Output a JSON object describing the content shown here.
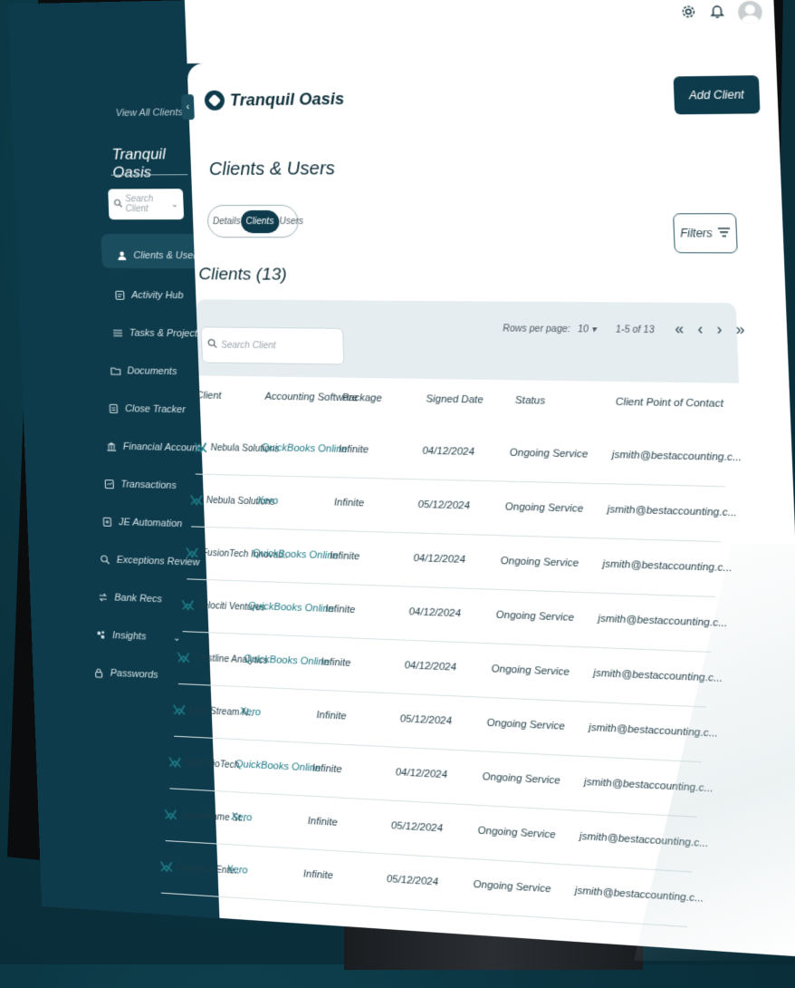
{
  "sidebar": {
    "view_all": "View All Clients",
    "org_name": "Tranquil Oasis",
    "search_placeholder": "Search Client",
    "items": [
      {
        "label": "Clients & Users",
        "icon": "users-icon"
      },
      {
        "label": "Activity Hub",
        "icon": "activity-icon"
      },
      {
        "label": "Tasks & Projects",
        "icon": "list-icon"
      },
      {
        "label": "Documents",
        "icon": "folder-icon"
      },
      {
        "label": "Close Tracker",
        "icon": "tracker-icon"
      },
      {
        "label": "Financial Accounts",
        "icon": "bank-icon"
      },
      {
        "label": "Transactions",
        "icon": "transactions-icon"
      },
      {
        "label": "JE Automation",
        "icon": "automation-icon"
      },
      {
        "label": "Exceptions Review",
        "icon": "exceptions-icon"
      },
      {
        "label": "Bank Recs",
        "icon": "recs-icon"
      },
      {
        "label": "Insights",
        "icon": "insights-icon"
      },
      {
        "label": "Passwords",
        "icon": "lock-icon"
      }
    ]
  },
  "header": {
    "brand": "Tranquil Oasis",
    "add_client": "Add Client"
  },
  "page": {
    "title": "Clients & Users",
    "tabs": [
      "Details",
      "Clients",
      "Users"
    ],
    "active_tab": "Clients",
    "filters": "Filters",
    "section_title": "Clients (13)"
  },
  "table": {
    "search_placeholder": "Search Client",
    "rows_per_page_label": "Rows per page:",
    "rows_per_page": "10",
    "range": "1-5 of 13",
    "columns": [
      "Client",
      "Accounting Software",
      "Package",
      "Signed Date",
      "Status",
      "Client Point of Contact"
    ],
    "rows": [
      [
        "Nebula Solutions",
        "QuickBooks Online",
        "Infinite",
        "04/12/2024",
        "Ongoing Service",
        "jsmith@bestaccounting.c..."
      ],
      [
        "Nebula Solutions",
        "Xero",
        "Infinite",
        "05/12/2024",
        "Ongoing Service",
        "jsmith@bestaccounting.c..."
      ],
      [
        "FusionTech Innovati..",
        "QuickBooks Online",
        "Infinite",
        "04/12/2024",
        "Ongoing Service",
        "jsmith@bestaccounting.c..."
      ],
      [
        "Velociti Ventures",
        "QuickBooks Online",
        "Infinite",
        "04/12/2024",
        "Ongoing Service",
        "jsmith@bestaccounting.c..."
      ],
      [
        "Crestline Analytics",
        "QuickBooks Online",
        "Infinite",
        "04/12/2024",
        "Ongoing Service",
        "jsmith@bestaccounting.c..."
      ],
      [
        "NovaStream N..",
        "Xero",
        "Infinite",
        "05/12/2024",
        "Ongoing Service",
        "jsmith@bestaccounting.c..."
      ],
      [
        "Solis BioTech",
        "QuickBooks Online",
        "Infinite",
        "04/12/2024",
        "Ongoing Service",
        "jsmith@bestaccounting.c..."
      ],
      [
        "LunarFrame St..",
        "Xero",
        "Infinite",
        "05/12/2024",
        "Ongoing Service",
        "jsmith@bestaccounting.c..."
      ],
      [
        "Quantum Ente..",
        "Xero",
        "Infinite",
        "05/12/2024",
        "Ongoing Service",
        "jsmith@bestaccounting.c..."
      ]
    ]
  },
  "colors": {
    "primary": "#0e3b4b",
    "link": "#1d7a86",
    "header_bg": "#e5edf0"
  }
}
